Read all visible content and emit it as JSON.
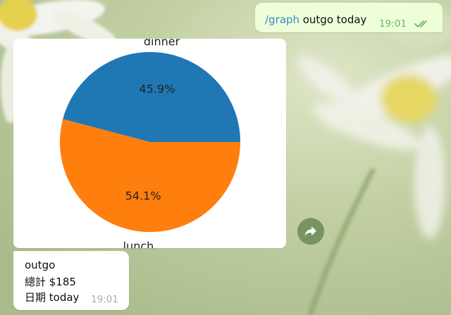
{
  "colors": {
    "outgoing_bubble": "#eefed8",
    "incoming_bubble": "#ffffff",
    "command_link": "#3a8ac9",
    "outgoing_time": "#6bb36a",
    "incoming_time": "#a3adb5",
    "forward_button": "#60804a"
  },
  "messages": {
    "outgoing": {
      "command": "/graph",
      "text": " outgo today",
      "time": "19:01",
      "status_icon": "double-check-icon"
    },
    "image": {
      "forward_icon": "share-arrow-icon"
    },
    "incoming": {
      "line1": "outgo",
      "line2": "總計 $185",
      "line3": "日期 today",
      "time": "19:01"
    }
  },
  "chart_data": {
    "type": "pie",
    "categories": [
      "dinner",
      "lunch"
    ],
    "values": [
      45.9,
      54.1
    ],
    "value_labels": [
      "45.9%",
      "54.1%"
    ],
    "colors": [
      "#1f77b4",
      "#ff7f0e"
    ]
  }
}
